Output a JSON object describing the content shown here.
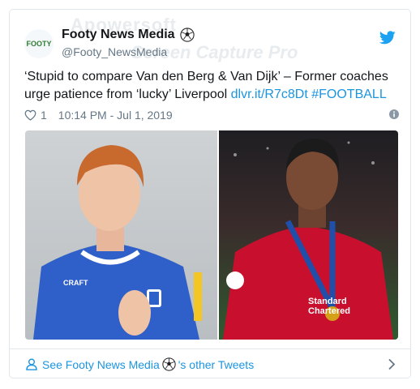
{
  "watermark": {
    "line1": "Apowersoft",
    "line2": "Screen Capture Pro"
  },
  "author": {
    "avatar_text": "FOOTY",
    "display_name": "Footy News Media",
    "handle": "@Footy_NewsMedia",
    "name_icon": "soccer-ball-icon"
  },
  "tweet": {
    "text": "‘Stupid to compare Van den Berg & Van Dijk’ – Former coaches urge patience from ‘lucky’ Liverpool ",
    "link": "dlvr.it/R7c8Dt",
    "hashtag": "#FOOTBALL",
    "likes": "1",
    "timestamp": "10:14 PM - Jul 1, 2019"
  },
  "media": {
    "left_jersey_text": "CRAFT",
    "right_jersey_text": "Standard Chartered"
  },
  "footer": {
    "prefix": "See Footy News Media",
    "suffix": "'s other Tweets"
  },
  "colors": {
    "link": "#1b95e0",
    "muted": "#657786",
    "border": "#e1e8ed"
  }
}
